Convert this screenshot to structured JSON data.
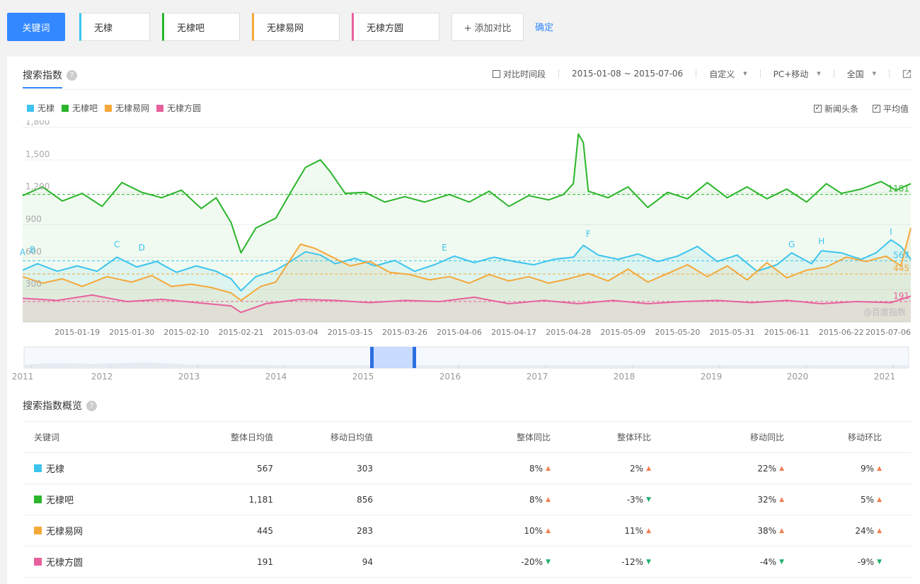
{
  "topbar": {
    "keyword_label": "关键词",
    "keywords": [
      {
        "text": "无棣",
        "color": "#3cc4ef"
      },
      {
        "text": "无棣吧",
        "color": "#2ab52a"
      },
      {
        "text": "无棣易网",
        "color": "#f5a83a"
      },
      {
        "text": "无棣方圆",
        "color": "#e8609e"
      }
    ],
    "add_label": "+ 添加对比",
    "confirm_label": "确定"
  },
  "search_index": {
    "title": "搜索指数",
    "help": "?",
    "compare_period_label": "对比时间段",
    "date_range": "2015-01-08 ~ 2015-07-06",
    "custom_label": "自定义",
    "device_label": "PC+移动",
    "region_label": "全国",
    "news_label": "新闻头条",
    "average_label": "平均值",
    "watermark": "@百度指数"
  },
  "timeline": {
    "years": [
      "2011",
      "2012",
      "2013",
      "2014",
      "2015",
      "2016",
      "2017",
      "2018",
      "2019",
      "2020",
      "2021"
    ],
    "selection_start": "2015-01-08",
    "selection_end": "2015-07-06"
  },
  "chart_data": {
    "type": "line",
    "x_ticks": [
      "2015-01-19",
      "2015-01-30",
      "2015-02-10",
      "2015-02-21",
      "2015-03-04",
      "2015-03-15",
      "2015-03-26",
      "2015-04-06",
      "2015-04-17",
      "2015-04-28",
      "2015-05-09",
      "2015-05-20",
      "2015-05-31",
      "2015-06-11",
      "2015-06-22",
      "2015-07-06"
    ],
    "y_ticks": [
      "1,800",
      "1,500",
      "1,200",
      "900",
      "600",
      "300"
    ],
    "ylim": [
      0,
      1800
    ],
    "x_range": [
      "2015-01-08",
      "2015-07-06"
    ],
    "annotations": [
      {
        "label": "A",
        "x": "2015-01-08",
        "y": 620
      },
      {
        "label": "B",
        "x": "2015-01-10",
        "y": 640
      },
      {
        "label": "C",
        "x": "2015-01-27",
        "y": 690
      },
      {
        "label": "D",
        "x": "2015-02-01",
        "y": 660
      },
      {
        "label": "E",
        "x": "2015-04-03",
        "y": 660
      },
      {
        "label": "F",
        "x": "2015-05-02",
        "y": 790
      },
      {
        "label": "G",
        "x": "2015-06-12",
        "y": 690
      },
      {
        "label": "H",
        "x": "2015-06-18",
        "y": 720
      },
      {
        "label": "I",
        "x": "2015-07-02",
        "y": 810
      }
    ],
    "series": [
      {
        "name": "无棣",
        "color": "#3cc4ef",
        "average": 567,
        "end_label": "567",
        "points": [
          [
            "2015-01-08",
            480
          ],
          [
            "2015-01-11",
            540
          ],
          [
            "2015-01-15",
            470
          ],
          [
            "2015-01-19",
            520
          ],
          [
            "2015-01-23",
            470
          ],
          [
            "2015-01-27",
            600
          ],
          [
            "2015-01-31",
            510
          ],
          [
            "2015-02-04",
            560
          ],
          [
            "2015-02-08",
            460
          ],
          [
            "2015-02-12",
            520
          ],
          [
            "2015-02-16",
            470
          ],
          [
            "2015-02-19",
            400
          ],
          [
            "2015-02-21",
            290
          ],
          [
            "2015-02-24",
            420
          ],
          [
            "2015-02-28",
            480
          ],
          [
            "2015-03-03",
            560
          ],
          [
            "2015-03-06",
            650
          ],
          [
            "2015-03-09",
            620
          ],
          [
            "2015-03-12",
            540
          ],
          [
            "2015-03-16",
            590
          ],
          [
            "2015-03-20",
            520
          ],
          [
            "2015-03-24",
            570
          ],
          [
            "2015-03-28",
            470
          ],
          [
            "2015-04-01",
            530
          ],
          [
            "2015-04-05",
            610
          ],
          [
            "2015-04-09",
            550
          ],
          [
            "2015-04-13",
            600
          ],
          [
            "2015-04-17",
            560
          ],
          [
            "2015-04-21",
            530
          ],
          [
            "2015-04-25",
            580
          ],
          [
            "2015-04-29",
            600
          ],
          [
            "2015-05-01",
            710
          ],
          [
            "2015-05-04",
            620
          ],
          [
            "2015-05-08",
            580
          ],
          [
            "2015-05-12",
            630
          ],
          [
            "2015-05-16",
            560
          ],
          [
            "2015-05-20",
            610
          ],
          [
            "2015-05-24",
            700
          ],
          [
            "2015-05-28",
            560
          ],
          [
            "2015-06-01",
            620
          ],
          [
            "2015-06-05",
            470
          ],
          [
            "2015-06-09",
            530
          ],
          [
            "2015-06-12",
            640
          ],
          [
            "2015-06-16",
            540
          ],
          [
            "2015-06-18",
            660
          ],
          [
            "2015-06-22",
            640
          ],
          [
            "2015-06-26",
            580
          ],
          [
            "2015-06-29",
            640
          ],
          [
            "2015-07-02",
            760
          ],
          [
            "2015-07-04",
            700
          ],
          [
            "2015-07-06",
            580
          ]
        ]
      },
      {
        "name": "无棣吧",
        "color": "#2ab52a",
        "average": 1181,
        "end_label": "1181",
        "points": [
          [
            "2015-01-08",
            1170
          ],
          [
            "2015-01-12",
            1250
          ],
          [
            "2015-01-16",
            1120
          ],
          [
            "2015-01-20",
            1190
          ],
          [
            "2015-01-24",
            1070
          ],
          [
            "2015-01-28",
            1290
          ],
          [
            "2015-02-01",
            1200
          ],
          [
            "2015-02-05",
            1150
          ],
          [
            "2015-02-09",
            1220
          ],
          [
            "2015-02-13",
            1050
          ],
          [
            "2015-02-16",
            1150
          ],
          [
            "2015-02-19",
            920
          ],
          [
            "2015-02-21",
            640
          ],
          [
            "2015-02-24",
            870
          ],
          [
            "2015-02-28",
            960
          ],
          [
            "2015-03-03",
            1200
          ],
          [
            "2015-03-06",
            1430
          ],
          [
            "2015-03-09",
            1500
          ],
          [
            "2015-03-11",
            1390
          ],
          [
            "2015-03-14",
            1190
          ],
          [
            "2015-03-18",
            1200
          ],
          [
            "2015-03-22",
            1110
          ],
          [
            "2015-03-26",
            1160
          ],
          [
            "2015-03-30",
            1110
          ],
          [
            "2015-04-04",
            1180
          ],
          [
            "2015-04-08",
            1110
          ],
          [
            "2015-04-12",
            1210
          ],
          [
            "2015-04-16",
            1070
          ],
          [
            "2015-04-20",
            1170
          ],
          [
            "2015-04-24",
            1130
          ],
          [
            "2015-04-27",
            1180
          ],
          [
            "2015-04-29",
            1280
          ],
          [
            "2015-04-30",
            1740
          ],
          [
            "2015-05-01",
            1660
          ],
          [
            "2015-05-02",
            1210
          ],
          [
            "2015-05-06",
            1150
          ],
          [
            "2015-05-10",
            1250
          ],
          [
            "2015-05-14",
            1060
          ],
          [
            "2015-05-18",
            1200
          ],
          [
            "2015-05-22",
            1140
          ],
          [
            "2015-05-26",
            1290
          ],
          [
            "2015-05-30",
            1150
          ],
          [
            "2015-06-03",
            1250
          ],
          [
            "2015-06-07",
            1140
          ],
          [
            "2015-06-11",
            1230
          ],
          [
            "2015-06-15",
            1110
          ],
          [
            "2015-06-19",
            1280
          ],
          [
            "2015-06-22",
            1190
          ],
          [
            "2015-06-26",
            1230
          ],
          [
            "2015-06-30",
            1300
          ],
          [
            "2015-07-03",
            1220
          ],
          [
            "2015-07-06",
            1280
          ]
        ]
      },
      {
        "name": "无棣易网",
        "color": "#f5a83a",
        "average": 445,
        "end_label": "445",
        "points": [
          [
            "2015-01-08",
            420
          ],
          [
            "2015-01-12",
            360
          ],
          [
            "2015-01-16",
            400
          ],
          [
            "2015-01-20",
            330
          ],
          [
            "2015-01-25",
            420
          ],
          [
            "2015-01-30",
            370
          ],
          [
            "2015-02-03",
            430
          ],
          [
            "2015-02-07",
            330
          ],
          [
            "2015-02-11",
            350
          ],
          [
            "2015-02-15",
            320
          ],
          [
            "2015-02-19",
            270
          ],
          [
            "2015-02-21",
            200
          ],
          [
            "2015-02-25",
            330
          ],
          [
            "2015-02-28",
            370
          ],
          [
            "2015-03-02",
            510
          ],
          [
            "2015-03-05",
            720
          ],
          [
            "2015-03-08",
            680
          ],
          [
            "2015-03-11",
            610
          ],
          [
            "2015-03-15",
            520
          ],
          [
            "2015-03-19",
            560
          ],
          [
            "2015-03-23",
            460
          ],
          [
            "2015-03-27",
            440
          ],
          [
            "2015-03-31",
            390
          ],
          [
            "2015-04-04",
            420
          ],
          [
            "2015-04-08",
            360
          ],
          [
            "2015-04-12",
            440
          ],
          [
            "2015-04-16",
            380
          ],
          [
            "2015-04-20",
            420
          ],
          [
            "2015-04-24",
            360
          ],
          [
            "2015-04-28",
            400
          ],
          [
            "2015-05-02",
            450
          ],
          [
            "2015-05-06",
            380
          ],
          [
            "2015-05-10",
            490
          ],
          [
            "2015-05-14",
            370
          ],
          [
            "2015-05-18",
            450
          ],
          [
            "2015-05-22",
            530
          ],
          [
            "2015-05-26",
            420
          ],
          [
            "2015-05-30",
            520
          ],
          [
            "2015-06-03",
            390
          ],
          [
            "2015-06-07",
            550
          ],
          [
            "2015-06-11",
            410
          ],
          [
            "2015-06-15",
            480
          ],
          [
            "2015-06-19",
            510
          ],
          [
            "2015-06-23",
            600
          ],
          [
            "2015-06-27",
            560
          ],
          [
            "2015-07-01",
            610
          ],
          [
            "2015-07-04",
            520
          ],
          [
            "2015-07-06",
            870
          ]
        ]
      },
      {
        "name": "无棣方圆",
        "color": "#e8609e",
        "average": 191,
        "end_label": "191",
        "points": [
          [
            "2015-01-08",
            220
          ],
          [
            "2015-01-15",
            200
          ],
          [
            "2015-01-22",
            250
          ],
          [
            "2015-01-29",
            190
          ],
          [
            "2015-02-05",
            210
          ],
          [
            "2015-02-12",
            180
          ],
          [
            "2015-02-19",
            150
          ],
          [
            "2015-02-21",
            90
          ],
          [
            "2015-02-26",
            170
          ],
          [
            "2015-03-05",
            210
          ],
          [
            "2015-03-12",
            200
          ],
          [
            "2015-03-19",
            180
          ],
          [
            "2015-03-26",
            200
          ],
          [
            "2015-04-02",
            190
          ],
          [
            "2015-04-09",
            230
          ],
          [
            "2015-04-16",
            170
          ],
          [
            "2015-04-23",
            200
          ],
          [
            "2015-04-30",
            170
          ],
          [
            "2015-05-07",
            200
          ],
          [
            "2015-05-14",
            170
          ],
          [
            "2015-05-21",
            190
          ],
          [
            "2015-05-28",
            200
          ],
          [
            "2015-06-04",
            180
          ],
          [
            "2015-06-11",
            200
          ],
          [
            "2015-06-18",
            170
          ],
          [
            "2015-06-25",
            190
          ],
          [
            "2015-07-02",
            180
          ],
          [
            "2015-07-06",
            240
          ]
        ]
      }
    ]
  },
  "overview": {
    "title": "搜索指数概览",
    "help": "?",
    "headers": [
      "关键词",
      "整体日均值",
      "移动日均值",
      "整体同比",
      "整体环比",
      "移动同比",
      "移动环比"
    ],
    "rows": [
      {
        "name": "无棣",
        "color": "#3cc4ef",
        "total_avg": "567",
        "mobile_avg": "303",
        "yoy": "8%",
        "yoy_dir": "up",
        "mom": "2%",
        "mom_dir": "up",
        "m_yoy": "22%",
        "m_yoy_dir": "up",
        "m_mom": "9%",
        "m_mom_dir": "up"
      },
      {
        "name": "无棣吧",
        "color": "#2ab52a",
        "total_avg": "1,181",
        "mobile_avg": "856",
        "yoy": "8%",
        "yoy_dir": "up",
        "mom": "-3%",
        "mom_dir": "down",
        "m_yoy": "32%",
        "m_yoy_dir": "up",
        "m_mom": "5%",
        "m_mom_dir": "up"
      },
      {
        "name": "无棣易网",
        "color": "#f5a83a",
        "total_avg": "445",
        "mobile_avg": "283",
        "yoy": "10%",
        "yoy_dir": "up",
        "mom": "11%",
        "mom_dir": "up",
        "m_yoy": "38%",
        "m_yoy_dir": "up",
        "m_mom": "24%",
        "m_mom_dir": "up"
      },
      {
        "name": "无棣方圆",
        "color": "#e8609e",
        "total_avg": "191",
        "mobile_avg": "94",
        "yoy": "-20%",
        "yoy_dir": "down",
        "mom": "-12%",
        "mom_dir": "down",
        "m_yoy": "-4%",
        "m_yoy_dir": "down",
        "m_mom": "-9%",
        "m_mom_dir": "down"
      }
    ]
  }
}
